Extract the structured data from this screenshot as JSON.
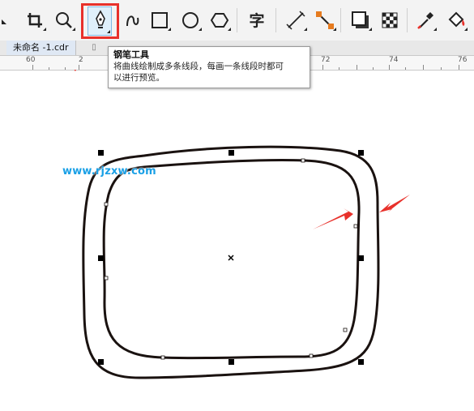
{
  "toolbar": {
    "tools": [
      {
        "name": "crop-tool",
        "icon": "crop-icon"
      },
      {
        "name": "zoom-tool",
        "icon": "magnifier-icon"
      },
      {
        "name": "pen-tool",
        "icon": "pen-nib-icon",
        "active": true
      },
      {
        "name": "bspline-tool",
        "icon": "curve-icon"
      },
      {
        "name": "rectangle-tool",
        "icon": "rectangle-icon"
      },
      {
        "name": "ellipse-tool",
        "icon": "ellipse-icon"
      },
      {
        "name": "polygon-tool",
        "icon": "hexagon-icon"
      },
      {
        "name": "text-tool",
        "icon": "text-icon",
        "label": "字"
      },
      {
        "name": "dimension-tool",
        "icon": "dimension-line-icon"
      },
      {
        "name": "connector-tool",
        "icon": "connector-icon"
      },
      {
        "name": "drop-shadow-tool",
        "icon": "drop-shadow-icon"
      },
      {
        "name": "transparency-tool",
        "icon": "checkerboard-icon"
      },
      {
        "name": "eyedropper-tool",
        "icon": "eyedropper-icon"
      },
      {
        "name": "fill-tool",
        "icon": "paint-bucket-icon"
      }
    ],
    "highlight_color": "#e8312b"
  },
  "document": {
    "tab_title": "未命名 -1.cdr"
  },
  "ruler": {
    "labels": [
      "60",
      "2",
      "72",
      "74",
      "76"
    ]
  },
  "tooltip": {
    "title": "钢笔工具",
    "body_line1": "将曲线绘制成多条线段，每画一条线段时都可",
    "body_line2": "以进行预览。"
  },
  "watermark": {
    "text": "www.rjzxw.com",
    "color": "#1aa0e6"
  },
  "annotations": {
    "arrow_color": "#e8312b"
  }
}
